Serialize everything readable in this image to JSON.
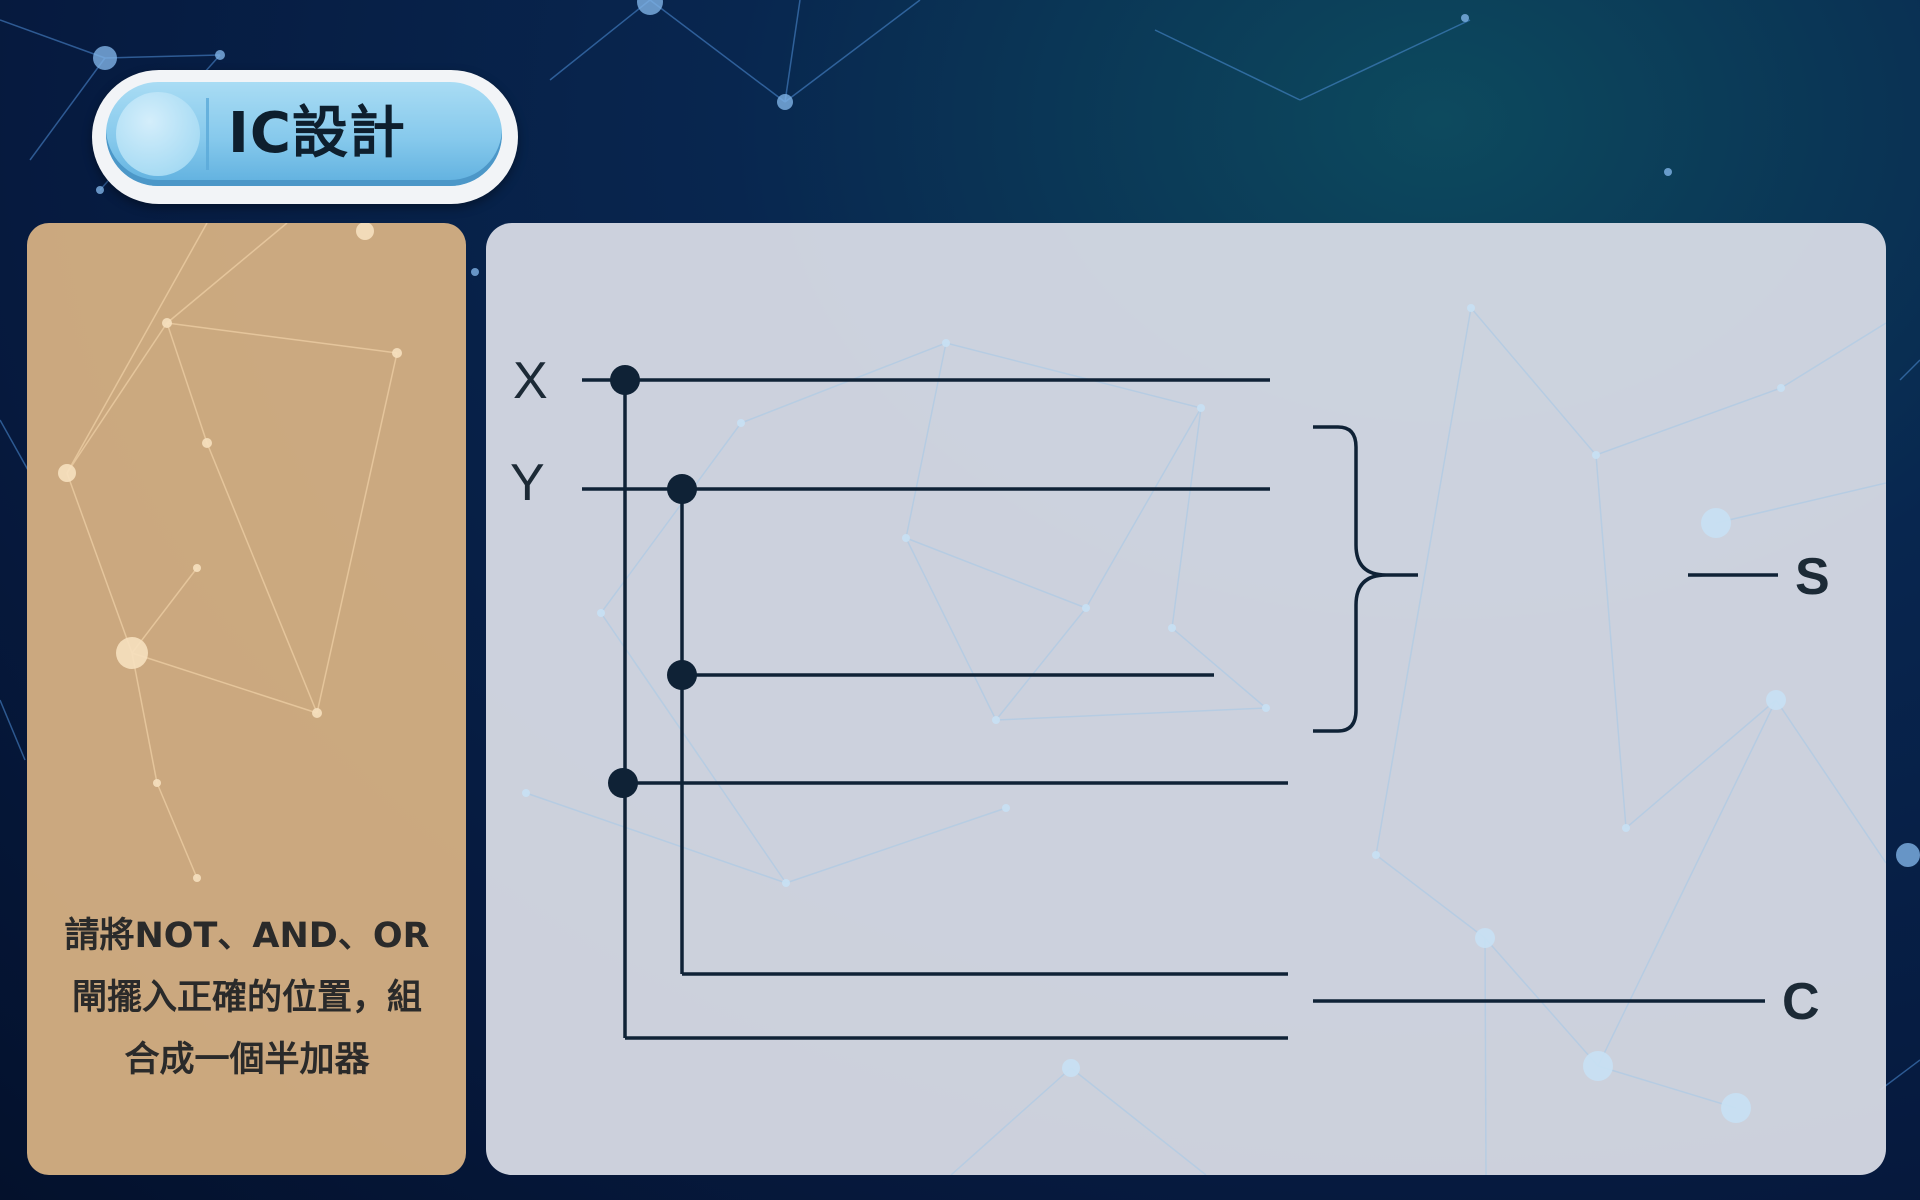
{
  "title": "IC設計",
  "instruction": {
    "lines": [
      "請將NOT、AND、OR",
      "閘擺入正確的位置，組",
      "合成一個半加器"
    ]
  },
  "diagram": {
    "inputs": {
      "x": "X",
      "y": "Y"
    },
    "outputs": {
      "sum": "S",
      "carry": "C"
    }
  },
  "colors": {
    "wire": "#0f2236",
    "side_panel": "#dab484",
    "main_panel": "#dcdfe8",
    "title_pill": "#86c9ec"
  }
}
